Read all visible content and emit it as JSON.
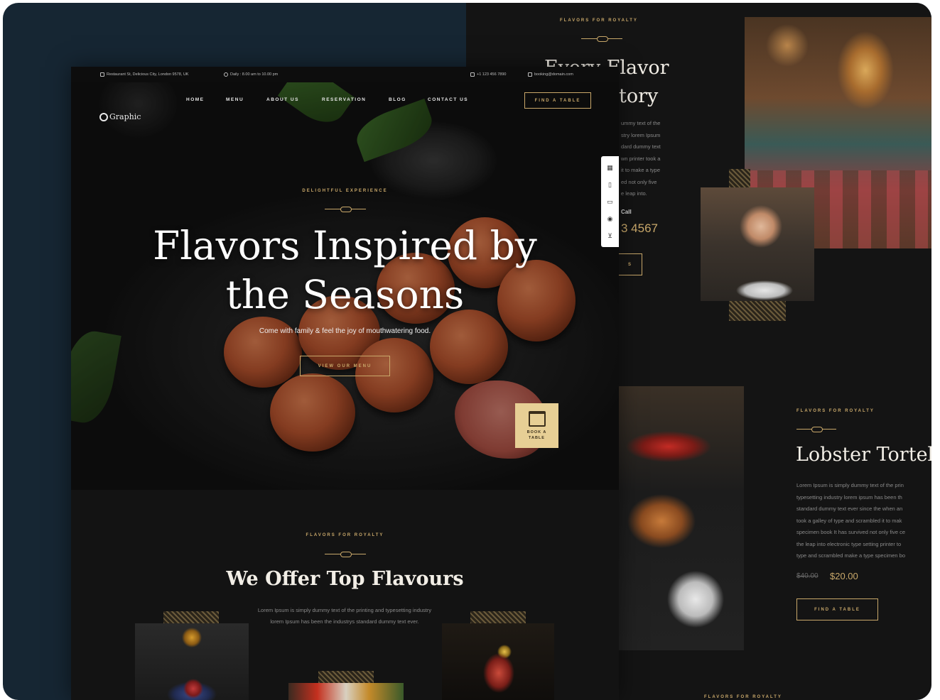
{
  "topbar": {
    "address": "Restaurant St, Delicious City, London 9578, UK",
    "hours": "Daily : 8.00 am to 10.00 pm",
    "phone": "+1 123 456 7890",
    "email": "booking@domain.com"
  },
  "logo": {
    "text": "Graphic"
  },
  "nav": {
    "items": [
      "HOME",
      "MENU",
      "ABOUT US",
      "RESERVATION",
      "BLOG",
      "CONTACT US"
    ],
    "cta": "FIND A TABLE"
  },
  "hero": {
    "eyebrow": "DELIGHTFUL EXPERIENCE",
    "title_line1": "Flavors Inspired by",
    "title_line2": "the Seasons",
    "subtitle": "Come with family & feel the joy of mouthwatering food.",
    "button": "VIEW OUR MENU",
    "book_line1": "BOOK A",
    "book_line2": "TABLE"
  },
  "offer": {
    "eyebrow": "FLAVORS FOR ROYALTY",
    "title": "We Offer Top Flavours",
    "body": "Lorem Ipsum is simply dummy text of the printing and typesetting industry lorem Ipsum has been the industrys standard dummy text ever."
  },
  "about": {
    "eyebrow": "FLAVORS FOR ROYALTY",
    "heading_line1": "Every Flavor",
    "heading_line2": "tory",
    "body_lines": [
      "ummy text of the",
      "stry lorem Ipsum",
      "dard dummy text",
      "wn printer took a",
      "it to make a type",
      "ed not only five",
      "e leap into."
    ],
    "call_label": "Call",
    "phone": "3 4567",
    "button": "S"
  },
  "dish": {
    "eyebrow": "FLAVORS FOR ROYALTY",
    "name": "Lobster Tortelli",
    "body_lines": [
      "Lorem Ipsum is simply dummy text of the prin",
      "typesetting industry lorem ipsum has been th",
      "standard dummy text ever since the when an",
      "took a galley of type and scrambled it to mak",
      "specimen book It has survived not only five ce",
      "the leap into electronic type setting printer to",
      "type and scrambled make a type specimen bo"
    ],
    "old_price": "$40.00",
    "price": "$20.00",
    "button": "FIND A TABLE"
  },
  "footer_eyebrow": "FLAVORS FOR ROYALTY",
  "sidebar_tools": [
    "layout-icon",
    "book-icon",
    "chat-icon",
    "support-icon",
    "cart-icon"
  ],
  "colors": {
    "accent": "#c9a86a",
    "background": "#162633",
    "panel": "#131313",
    "book_tile": "#e7cf95"
  }
}
